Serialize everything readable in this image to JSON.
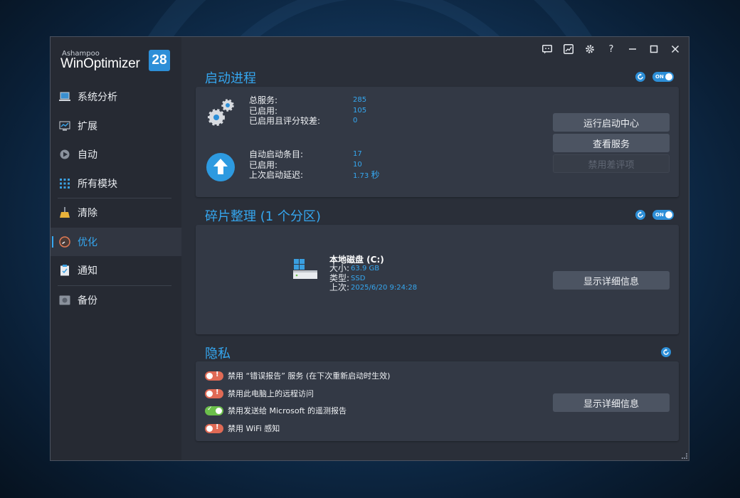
{
  "app": {
    "brand_small": "Ashampoo",
    "brand_name": "WinOptimizer",
    "version": "28"
  },
  "sidebar": {
    "items": [
      {
        "label": "系统分析",
        "icon": "laptop-icon"
      },
      {
        "label": "扩展",
        "icon": "monitor-chart-icon"
      },
      {
        "label": "自动",
        "icon": "play-gear-icon"
      },
      {
        "label": "所有模块",
        "icon": "grid-dots-icon"
      },
      {
        "label": "清除",
        "icon": "broom-icon"
      },
      {
        "label": "优化",
        "icon": "speedometer-icon"
      },
      {
        "label": "通知",
        "icon": "clipboard-check-icon"
      },
      {
        "label": "备份",
        "icon": "drive-icon"
      }
    ],
    "active_index": 5
  },
  "toolbar": {
    "icons": [
      "feedback-icon",
      "theme-icon",
      "settings-icon",
      "help-icon",
      "minimize-icon",
      "maximize-icon",
      "close-icon"
    ]
  },
  "startup": {
    "title": "启动进程",
    "toggle_label": "ON",
    "services": {
      "total_label": "总服务:",
      "total_value": "285",
      "enabled_label": "已启用:",
      "enabled_value": "105",
      "poor_label": "已启用且评分较差:",
      "poor_value": "0"
    },
    "autostart": {
      "entries_label": "自动启动条目:",
      "entries_value": "17",
      "enabled_label": "已启用:",
      "enabled_value": "10",
      "delay_label": "上次启动延迟:",
      "delay_value": "1.73",
      "delay_unit": "秒"
    },
    "buttons": {
      "run_center": "运行启动中心",
      "view_services": "查看服务",
      "disable_poor": "禁用差评项"
    }
  },
  "defrag": {
    "title": "碎片整理 (1 个分区)",
    "toggle_label": "ON",
    "disk_name": "本地磁盘 (C:)",
    "size_label": "大小:",
    "size_value": "63.9 GB",
    "type_label": "类型:",
    "type_value": "SSD",
    "last_label": "上次:",
    "last_value": "2025/6/20 9:24:28",
    "details_button": "显示详细信息"
  },
  "privacy": {
    "title": "隐私",
    "items": [
      {
        "label": "禁用 “错误报告” 服务 (在下次重新启动时生效)",
        "state": "off"
      },
      {
        "label": "禁用此电脑上的远程访问",
        "state": "off"
      },
      {
        "label": "禁用发送给 Microsoft 的遥测报告",
        "state": "on"
      },
      {
        "label": "禁用 WiFi 感知",
        "state": "off"
      }
    ],
    "details_button": "显示详细信息"
  },
  "colors": {
    "accent": "#35a7f0",
    "sidebar_bg": "#262a33",
    "panel_bg": "#333945",
    "button_bg": "#4c5462",
    "switch_off": "#e06a55",
    "switch_on": "#6bbf4b"
  }
}
